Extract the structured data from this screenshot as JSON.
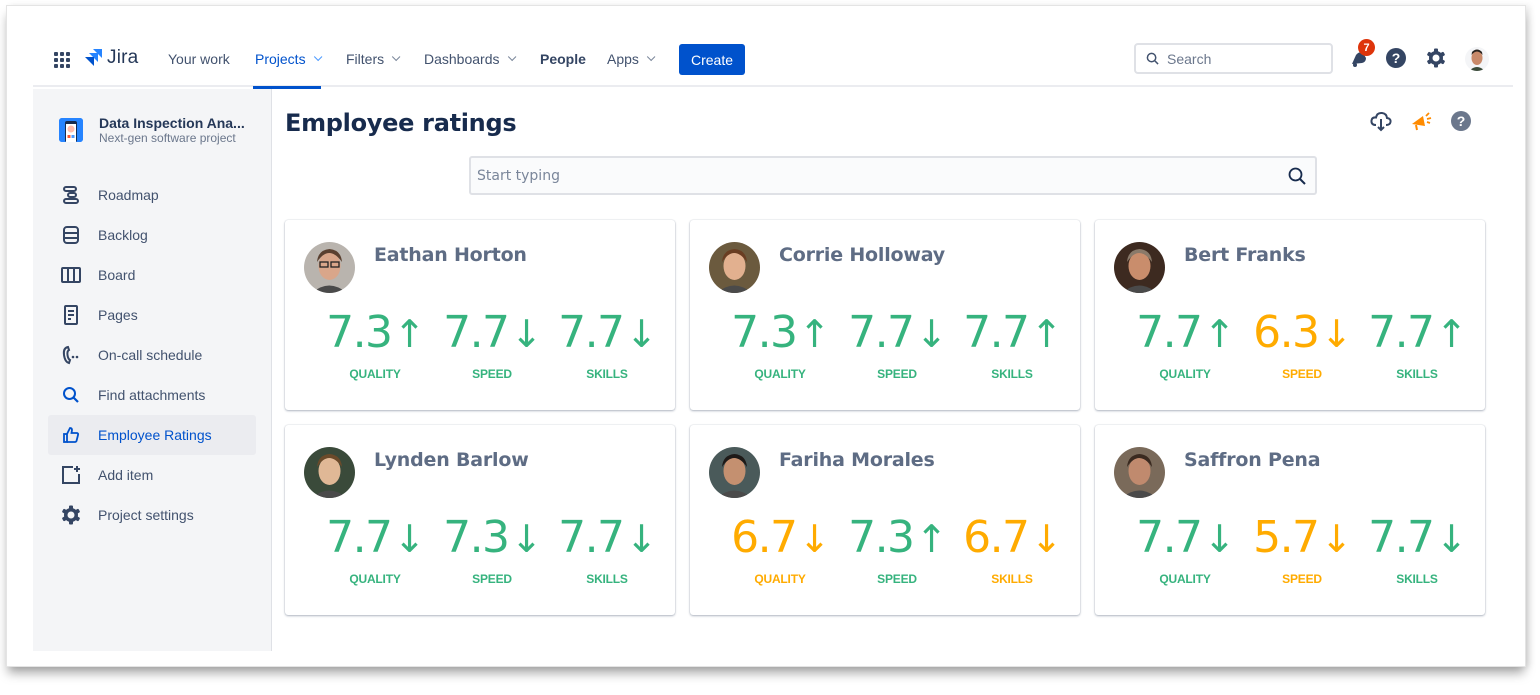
{
  "topnav": {
    "logo_text": "Jira",
    "items": [
      {
        "label": "Your work",
        "dropdown": false,
        "active": false,
        "bold": false
      },
      {
        "label": "Projects",
        "dropdown": true,
        "active": true,
        "bold": false
      },
      {
        "label": "Filters",
        "dropdown": true,
        "active": false,
        "bold": false
      },
      {
        "label": "Dashboards",
        "dropdown": true,
        "active": false,
        "bold": false
      },
      {
        "label": "People",
        "dropdown": false,
        "active": false,
        "bold": true
      },
      {
        "label": "Apps",
        "dropdown": true,
        "active": false,
        "bold": false
      }
    ],
    "create_label": "Create",
    "search_placeholder": "Search",
    "notifications_count": "7",
    "icons": [
      "notifications-icon",
      "help-icon",
      "settings-icon",
      "profile-avatar"
    ]
  },
  "sidebar": {
    "project_name": "Data Inspection Ana...",
    "project_type": "Next-gen software project",
    "items": [
      {
        "label": "Roadmap",
        "icon": "roadmap-icon",
        "active": false
      },
      {
        "label": "Backlog",
        "icon": "backlog-icon",
        "active": false
      },
      {
        "label": "Board",
        "icon": "board-icon",
        "active": false
      },
      {
        "label": "Pages",
        "icon": "pages-icon",
        "active": false
      },
      {
        "label": "On-call schedule",
        "icon": "on-call-icon",
        "active": false
      },
      {
        "label": "Find attachments",
        "icon": "search-icon",
        "active": false
      },
      {
        "label": "Employee Ratings",
        "icon": "thumbs-up-icon",
        "active": true
      },
      {
        "label": "Add item",
        "icon": "add-item-icon",
        "active": false
      },
      {
        "label": "Project settings",
        "icon": "gear-icon",
        "active": false
      }
    ]
  },
  "main": {
    "title": "Employee ratings",
    "search_placeholder": "Start typing",
    "actions": [
      "cloud-download-icon",
      "megaphone-icon",
      "help-icon"
    ]
  },
  "colors": {
    "good": "#36b37e",
    "warn": "#ffab00",
    "brand": "#0052cc"
  },
  "metric_labels": [
    "QUALITY",
    "SPEED",
    "SKILLS"
  ],
  "employees": [
    {
      "name": "Eathan Horton",
      "metrics": [
        {
          "label": "QUALITY",
          "value": "7.3",
          "trend": "up",
          "arrow": "↑",
          "status": "good"
        },
        {
          "label": "SPEED",
          "value": "7.7",
          "trend": "down",
          "arrow": "↓",
          "status": "good"
        },
        {
          "label": "SKILLS",
          "value": "7.7",
          "trend": "down",
          "arrow": "↓",
          "status": "good"
        }
      ]
    },
    {
      "name": "Corrie Holloway",
      "metrics": [
        {
          "label": "QUALITY",
          "value": "7.3",
          "trend": "up",
          "arrow": "↑",
          "status": "good"
        },
        {
          "label": "SPEED",
          "value": "7.7",
          "trend": "down",
          "arrow": "↓",
          "status": "good"
        },
        {
          "label": "SKILLS",
          "value": "7.7",
          "trend": "up",
          "arrow": "↑",
          "status": "good"
        }
      ]
    },
    {
      "name": "Bert Franks",
      "metrics": [
        {
          "label": "QUALITY",
          "value": "7.7",
          "trend": "up",
          "arrow": "↑",
          "status": "good"
        },
        {
          "label": "SPEED",
          "value": "6.3",
          "trend": "down",
          "arrow": "↓",
          "status": "warn"
        },
        {
          "label": "SKILLS",
          "value": "7.7",
          "trend": "up",
          "arrow": "↑",
          "status": "good"
        }
      ]
    },
    {
      "name": "Lynden Barlow",
      "metrics": [
        {
          "label": "QUALITY",
          "value": "7.7",
          "trend": "down",
          "arrow": "↓",
          "status": "good"
        },
        {
          "label": "SPEED",
          "value": "7.3",
          "trend": "down",
          "arrow": "↓",
          "status": "good"
        },
        {
          "label": "SKILLS",
          "value": "7.7",
          "trend": "down",
          "arrow": "↓",
          "status": "good"
        }
      ]
    },
    {
      "name": "Fariha Morales",
      "metrics": [
        {
          "label": "QUALITY",
          "value": "6.7",
          "trend": "down",
          "arrow": "↓",
          "status": "warn"
        },
        {
          "label": "SPEED",
          "value": "7.3",
          "trend": "up",
          "arrow": "↑",
          "status": "good"
        },
        {
          "label": "SKILLS",
          "value": "6.7",
          "trend": "down",
          "arrow": "↓",
          "status": "warn"
        }
      ]
    },
    {
      "name": "Saffron Pena",
      "metrics": [
        {
          "label": "QUALITY",
          "value": "7.7",
          "trend": "down",
          "arrow": "↓",
          "status": "good"
        },
        {
          "label": "SPEED",
          "value": "5.7",
          "trend": "down",
          "arrow": "↓",
          "status": "warn"
        },
        {
          "label": "SKILLS",
          "value": "7.7",
          "trend": "down",
          "arrow": "↓",
          "status": "good"
        }
      ]
    }
  ]
}
